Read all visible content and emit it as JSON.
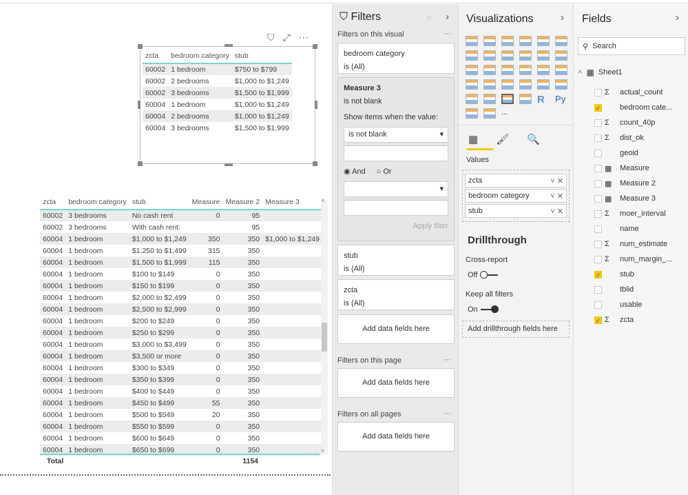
{
  "top_visual": {
    "headers": [
      "zcta",
      "bedroom category",
      "stub"
    ],
    "rows": [
      [
        "60002",
        "1 bedroom",
        "$750 to $799"
      ],
      [
        "60002",
        "2 bedrooms",
        "$1,000 to $1,249"
      ],
      [
        "60002",
        "3 bedrooms",
        "$1,500 to $1,999"
      ],
      [
        "60004",
        "1 bedroom",
        "$1,000 to $1,249"
      ],
      [
        "60004",
        "2 bedrooms",
        "$1,000 to $1,249"
      ],
      [
        "60004",
        "3 bedrooms",
        "$1,500 to $1,999"
      ]
    ]
  },
  "main_table": {
    "headers": [
      "zcta",
      "bedroom category",
      "stub",
      "Measure",
      "Measure 2",
      "Measure 3"
    ],
    "rows": [
      [
        "60002",
        "3 bedrooms",
        "No cash rent",
        "0",
        "95",
        ""
      ],
      [
        "60002",
        "3 bedrooms",
        "With cash rent:",
        "",
        "95",
        ""
      ],
      [
        "60004",
        "1 bedroom",
        "$1,000 to $1,249",
        "350",
        "350",
        "$1,000 to $1,249"
      ],
      [
        "60004",
        "1 bedroom",
        "$1,250 to $1,499",
        "315",
        "350",
        ""
      ],
      [
        "60004",
        "1 bedroom",
        "$1,500 to $1,999",
        "115",
        "350",
        ""
      ],
      [
        "60004",
        "1 bedroom",
        "$100 to $149",
        "0",
        "350",
        ""
      ],
      [
        "60004",
        "1 bedroom",
        "$150 to $199",
        "0",
        "350",
        ""
      ],
      [
        "60004",
        "1 bedroom",
        "$2,000 to $2,499",
        "0",
        "350",
        ""
      ],
      [
        "60004",
        "1 bedroom",
        "$2,500 to $2,999",
        "0",
        "350",
        ""
      ],
      [
        "60004",
        "1 bedroom",
        "$200 to $249",
        "0",
        "350",
        ""
      ],
      [
        "60004",
        "1 bedroom",
        "$250 to $299",
        "0",
        "350",
        ""
      ],
      [
        "60004",
        "1 bedroom",
        "$3,000 to $3,499",
        "0",
        "350",
        ""
      ],
      [
        "60004",
        "1 bedroom",
        "$3,500 or more",
        "0",
        "350",
        ""
      ],
      [
        "60004",
        "1 bedroom",
        "$300 to $349",
        "0",
        "350",
        ""
      ],
      [
        "60004",
        "1 bedroom",
        "$350 to $399",
        "0",
        "350",
        ""
      ],
      [
        "60004",
        "1 bedroom",
        "$400 to $449",
        "0",
        "350",
        ""
      ],
      [
        "60004",
        "1 bedroom",
        "$450 to $499",
        "55",
        "350",
        ""
      ],
      [
        "60004",
        "1 bedroom",
        "$500 to $549",
        "20",
        "350",
        ""
      ],
      [
        "60004",
        "1 bedroom",
        "$550 to $599",
        "0",
        "350",
        ""
      ],
      [
        "60004",
        "1 bedroom",
        "$600 to $649",
        "0",
        "350",
        ""
      ],
      [
        "60004",
        "1 bedroom",
        "$650 to $699",
        "0",
        "350",
        ""
      ]
    ],
    "total_label": "Total",
    "total_measure2": "1154"
  },
  "filters": {
    "title": "Filters",
    "on_visual": "Filters on this visual",
    "card1": {
      "field": "bedroom category",
      "state": "is (All)"
    },
    "card2": {
      "field": "Measure 3",
      "state": "is not blank",
      "show_label": "Show items when the value:",
      "condition": "is not blank",
      "and": "And",
      "or": "Or",
      "apply": "Apply filter"
    },
    "card3": {
      "field": "stub",
      "state": "is (All)"
    },
    "card4": {
      "field": "zcta",
      "state": "is (All)"
    },
    "add": "Add data fields here",
    "on_page": "Filters on this page",
    "on_all": "Filters on all pages"
  },
  "viz": {
    "title": "Visualizations",
    "values_label": "Values",
    "wells": [
      "zcta",
      "bedroom category",
      "stub"
    ],
    "drill_title": "Drillthrough",
    "cross_report": "Cross-report",
    "off": "Off",
    "keep_all": "Keep all filters",
    "on": "On",
    "add_drill": "Add drillthrough fields here",
    "more": "...",
    "r_label": "R",
    "py_label": "Py"
  },
  "fields": {
    "title": "Fields",
    "search_placeholder": "Search",
    "table": "Sheet1",
    "items": [
      {
        "name": "actual_count",
        "type": "sigma",
        "checked": false
      },
      {
        "name": "bedroom cate...",
        "type": "",
        "checked": true
      },
      {
        "name": "count_40p",
        "type": "sigma",
        "checked": false
      },
      {
        "name": "dist_ok",
        "type": "sigma",
        "checked": false
      },
      {
        "name": "geoid",
        "type": "",
        "checked": false
      },
      {
        "name": "Measure",
        "type": "calc",
        "checked": false
      },
      {
        "name": "Measure 2",
        "type": "calc",
        "checked": false
      },
      {
        "name": "Measure 3",
        "type": "calc",
        "checked": false
      },
      {
        "name": "moer_interval",
        "type": "sigma",
        "checked": false
      },
      {
        "name": "name",
        "type": "",
        "checked": false
      },
      {
        "name": "num_estimate",
        "type": "sigma",
        "checked": false
      },
      {
        "name": "num_margin_...",
        "type": "sigma",
        "checked": false
      },
      {
        "name": "stub",
        "type": "",
        "checked": true
      },
      {
        "name": "tblid",
        "type": "",
        "checked": false
      },
      {
        "name": "usable",
        "type": "",
        "checked": false
      },
      {
        "name": "zcta",
        "type": "sigma",
        "checked": true
      }
    ]
  },
  "colors": {
    "accent": "#f2c811",
    "table_rule": "#7cd3cf"
  }
}
